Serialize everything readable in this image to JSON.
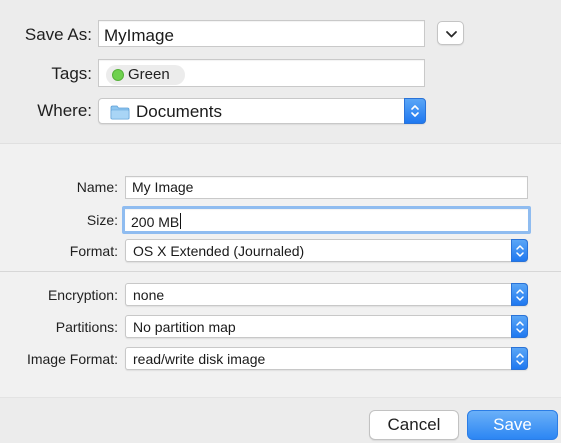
{
  "top": {
    "save_as_label": "Save As:",
    "save_as_value": "MyImage",
    "tags_label": "Tags:",
    "tag": {
      "name": "Green",
      "color": "#6fd14f"
    },
    "where_label": "Where:",
    "where_value": "Documents"
  },
  "form": {
    "name_label": "Name:",
    "name_value": "My Image",
    "size_label": "Size:",
    "size_value": "200 MB",
    "format_label": "Format:",
    "format_value": "OS X Extended (Journaled)",
    "encryption_label": "Encryption:",
    "encryption_value": "none",
    "partitions_label": "Partitions:",
    "partitions_value": "No partition map",
    "image_format_label": "Image Format:",
    "image_format_value": "read/write disk image"
  },
  "buttons": {
    "cancel": "Cancel",
    "save": "Save"
  },
  "colors": {
    "accent": "#2c86f3",
    "focus_ring": "#7fb4f2"
  }
}
